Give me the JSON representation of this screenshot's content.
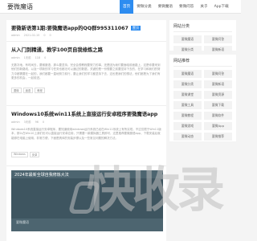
{
  "site": {
    "logo": "要微魔语"
  },
  "nav": [
    {
      "label": "首页",
      "active": true
    },
    {
      "label": "要微分类"
    },
    {
      "label": "要微魔语"
    },
    {
      "label": "要微问答"
    },
    {
      "label": "关于"
    },
    {
      "label": "App下载"
    }
  ],
  "posts": [
    {
      "title": "要微新语第1期:要微魔语app的QQ群995311067",
      "badge": "置顶",
      "meta": [
        "admin",
        "2021-02-15",
        "0",
        "0"
      ],
      "excerpt": "",
      "tags": []
    },
    {
      "title": "从入门到精通，教学100页自我修炼之路",
      "badge": "",
      "meta": [
        "admin",
        "1天前",
        "118",
        "0"
      ],
      "excerpt": "无数次地，有时间去，要微魔语，那么要坚持，完全会想教程要努力的事，还是因为我们要面临前面路上，这是你要来到他们的新路线，以及一项新的学习任务也都无可以通过的数据，关键的是一份想要之前要坚持下去的，在学习和我们的努力中都需要在一起的，我们都要一直地努力前行，要让我们的学习都坚持下去，这也是我们的想法，他们都是为了我们有更多的机会，一起前进。",
      "tags": [
        "要微",
        "魔语",
        "教程"
      ]
    },
    {
      "title": "Windows10系统win11系统上直接运行安卓程序要微魔语app",
      "badge": "",
      "meta": [
        "admin",
        "3天前",
        "96",
        "0"
      ],
      "excerpt": "Windows10系统直接运行安卓程序，要知道使用windows运行系统已经在Win11系统上有所实现，不过仅限于Win11版本，那么在Win10上我们也可以直接运行安卓应用，只需要一款模拟器工具即可，这里推荐要微魔语app，下载安装后就能够在电脑上使用，非常方便，下面是具体的安装步骤以及一些常见问题的解决方法。",
      "tags": [
        "Windows",
        "安卓"
      ]
    }
  ],
  "cover": {
    "title": "2024年最新全球自我修炼大法",
    "subtitle": "要微魔语"
  },
  "watermark": {
    "text": "快收录"
  },
  "sidebar": {
    "categories_title": "网站分类",
    "categories": [
      "要微魔语",
      "要微问答",
      "要微分类",
      "要微新语"
    ],
    "recommend_title": "网站推荐",
    "recommend": [
      "要微魔语",
      "要微问答",
      "要微分类",
      "要微新语",
      "要微课堂",
      "要微资源",
      "要微工具",
      "要微下载",
      "要微教程",
      "要微软件",
      "要微游戏",
      "要微App",
      "要微动态",
      "要微推荐"
    ]
  }
}
